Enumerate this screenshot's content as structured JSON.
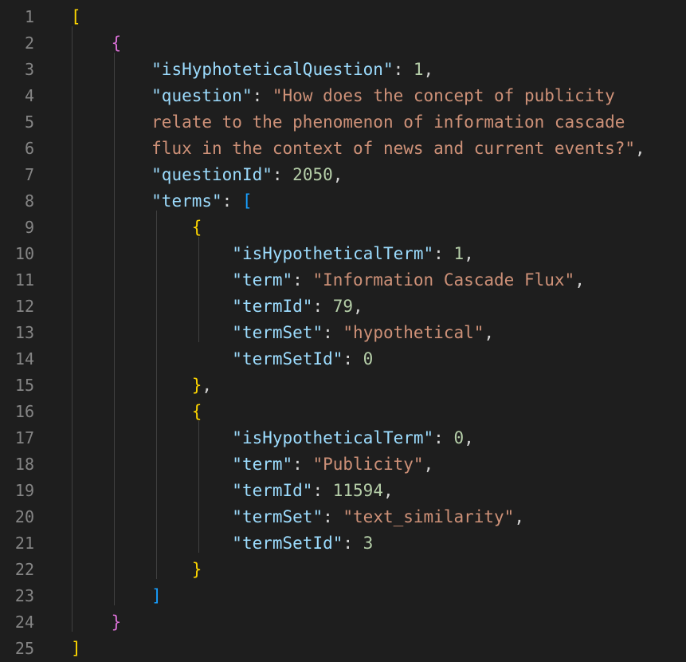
{
  "editor": {
    "line_numbers": [
      "1",
      "2",
      "3",
      "4",
      "5",
      "6",
      "7",
      "8",
      "9",
      "10",
      "11",
      "12",
      "13",
      "14",
      "15",
      "16",
      "17",
      "18",
      "19",
      "20",
      "21",
      "22",
      "23",
      "24",
      "25"
    ],
    "lines": [
      [
        {
          "t": "[",
          "c": "b1"
        }
      ],
      [
        {
          "t": "    "
        },
        {
          "t": "{",
          "c": "b2"
        }
      ],
      [
        {
          "t": "        "
        },
        {
          "t": "\"isHyphoteticalQuestion\"",
          "c": "k"
        },
        {
          "t": ": ",
          "c": "p"
        },
        {
          "t": "1",
          "c": "n"
        },
        {
          "t": ",",
          "c": "p"
        }
      ],
      [
        {
          "t": "        "
        },
        {
          "t": "\"question\"",
          "c": "k"
        },
        {
          "t": ": ",
          "c": "p"
        },
        {
          "t": "\"How does the concept of publicity",
          "c": "s"
        }
      ],
      [
        {
          "t": "        "
        },
        {
          "t": "relate to the phenomenon of information cascade",
          "c": "s"
        }
      ],
      [
        {
          "t": "        "
        },
        {
          "t": "flux in the context of news and current events?\"",
          "c": "s"
        },
        {
          "t": ",",
          "c": "p"
        }
      ],
      [
        {
          "t": "        "
        },
        {
          "t": "\"questionId\"",
          "c": "k"
        },
        {
          "t": ": ",
          "c": "p"
        },
        {
          "t": "2050",
          "c": "n"
        },
        {
          "t": ",",
          "c": "p"
        }
      ],
      [
        {
          "t": "        "
        },
        {
          "t": "\"terms\"",
          "c": "k"
        },
        {
          "t": ": ",
          "c": "p"
        },
        {
          "t": "[",
          "c": "b3"
        }
      ],
      [
        {
          "t": "            "
        },
        {
          "t": "{",
          "c": "b1"
        }
      ],
      [
        {
          "t": "                "
        },
        {
          "t": "\"isHypotheticalTerm\"",
          "c": "k"
        },
        {
          "t": ": ",
          "c": "p"
        },
        {
          "t": "1",
          "c": "n"
        },
        {
          "t": ",",
          "c": "p"
        }
      ],
      [
        {
          "t": "                "
        },
        {
          "t": "\"term\"",
          "c": "k"
        },
        {
          "t": ": ",
          "c": "p"
        },
        {
          "t": "\"Information Cascade Flux\"",
          "c": "s"
        },
        {
          "t": ",",
          "c": "p"
        }
      ],
      [
        {
          "t": "                "
        },
        {
          "t": "\"termId\"",
          "c": "k"
        },
        {
          "t": ": ",
          "c": "p"
        },
        {
          "t": "79",
          "c": "n"
        },
        {
          "t": ",",
          "c": "p"
        }
      ],
      [
        {
          "t": "                "
        },
        {
          "t": "\"termSet\"",
          "c": "k"
        },
        {
          "t": ": ",
          "c": "p"
        },
        {
          "t": "\"hypothetical\"",
          "c": "s"
        },
        {
          "t": ",",
          "c": "p"
        }
      ],
      [
        {
          "t": "                "
        },
        {
          "t": "\"termSetId\"",
          "c": "k"
        },
        {
          "t": ": ",
          "c": "p"
        },
        {
          "t": "0",
          "c": "n"
        }
      ],
      [
        {
          "t": "            "
        },
        {
          "t": "}",
          "c": "b1"
        },
        {
          "t": ",",
          "c": "p"
        }
      ],
      [
        {
          "t": "            "
        },
        {
          "t": "{",
          "c": "b1"
        }
      ],
      [
        {
          "t": "                "
        },
        {
          "t": "\"isHypotheticalTerm\"",
          "c": "k"
        },
        {
          "t": ": ",
          "c": "p"
        },
        {
          "t": "0",
          "c": "n"
        },
        {
          "t": ",",
          "c": "p"
        }
      ],
      [
        {
          "t": "                "
        },
        {
          "t": "\"term\"",
          "c": "k"
        },
        {
          "t": ": ",
          "c": "p"
        },
        {
          "t": "\"Publicity\"",
          "c": "s"
        },
        {
          "t": ",",
          "c": "p"
        }
      ],
      [
        {
          "t": "                "
        },
        {
          "t": "\"termId\"",
          "c": "k"
        },
        {
          "t": ": ",
          "c": "p"
        },
        {
          "t": "11594",
          "c": "n"
        },
        {
          "t": ",",
          "c": "p"
        }
      ],
      [
        {
          "t": "                "
        },
        {
          "t": "\"termSet\"",
          "c": "k"
        },
        {
          "t": ": ",
          "c": "p"
        },
        {
          "t": "\"text_similarity\"",
          "c": "s"
        },
        {
          "t": ",",
          "c": "p"
        }
      ],
      [
        {
          "t": "                "
        },
        {
          "t": "\"termSetId\"",
          "c": "k"
        },
        {
          "t": ": ",
          "c": "p"
        },
        {
          "t": "3",
          "c": "n"
        }
      ],
      [
        {
          "t": "            "
        },
        {
          "t": "}",
          "c": "b1"
        }
      ],
      [
        {
          "t": "        "
        },
        {
          "t": "]",
          "c": "b3"
        }
      ],
      [
        {
          "t": "    "
        },
        {
          "t": "}",
          "c": "b2"
        }
      ],
      [
        {
          "t": "]",
          "c": "b1"
        }
      ]
    ]
  },
  "colors": {
    "background": "#1e1e1e",
    "line_number": "#858585",
    "key": "#9cdcfe",
    "string": "#ce9178",
    "number": "#b5cea8",
    "punctuation": "#d4d4d4",
    "bracket_gold": "#ffd700",
    "bracket_orchid": "#da70d6",
    "bracket_blue": "#179fff",
    "indent_guide": "#404040"
  }
}
